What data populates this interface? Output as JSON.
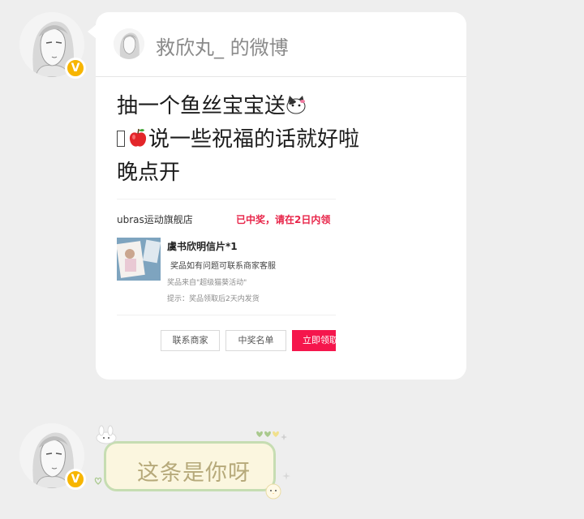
{
  "card": {
    "header_title": "救欣丸_ 的微博",
    "post_lines": [
      "抽一个鱼丝宝宝送",
      "说一些祝福的话就好啦",
      "晚点开"
    ]
  },
  "prize": {
    "shop_name": "ubras运动旗舰店",
    "status": "已中奖，请在2日内领",
    "item_title": "虞书欣明信片*1",
    "note_issue": "奖品如有问题可联系商家客服",
    "note_source": "奖品来自\"超级猫葵活动\"",
    "note_tip": "提示：奖品领取后2天内发货",
    "buttons": {
      "contact": "联系商家",
      "winners": "中奖名单",
      "claim": "立即领取"
    }
  },
  "reply": {
    "text": "这条是你呀"
  },
  "badge": {
    "symbol": "V",
    "color": "#f7b500"
  },
  "colors": {
    "accent_red": "#e8264a",
    "claim_button": "#f5164c"
  }
}
